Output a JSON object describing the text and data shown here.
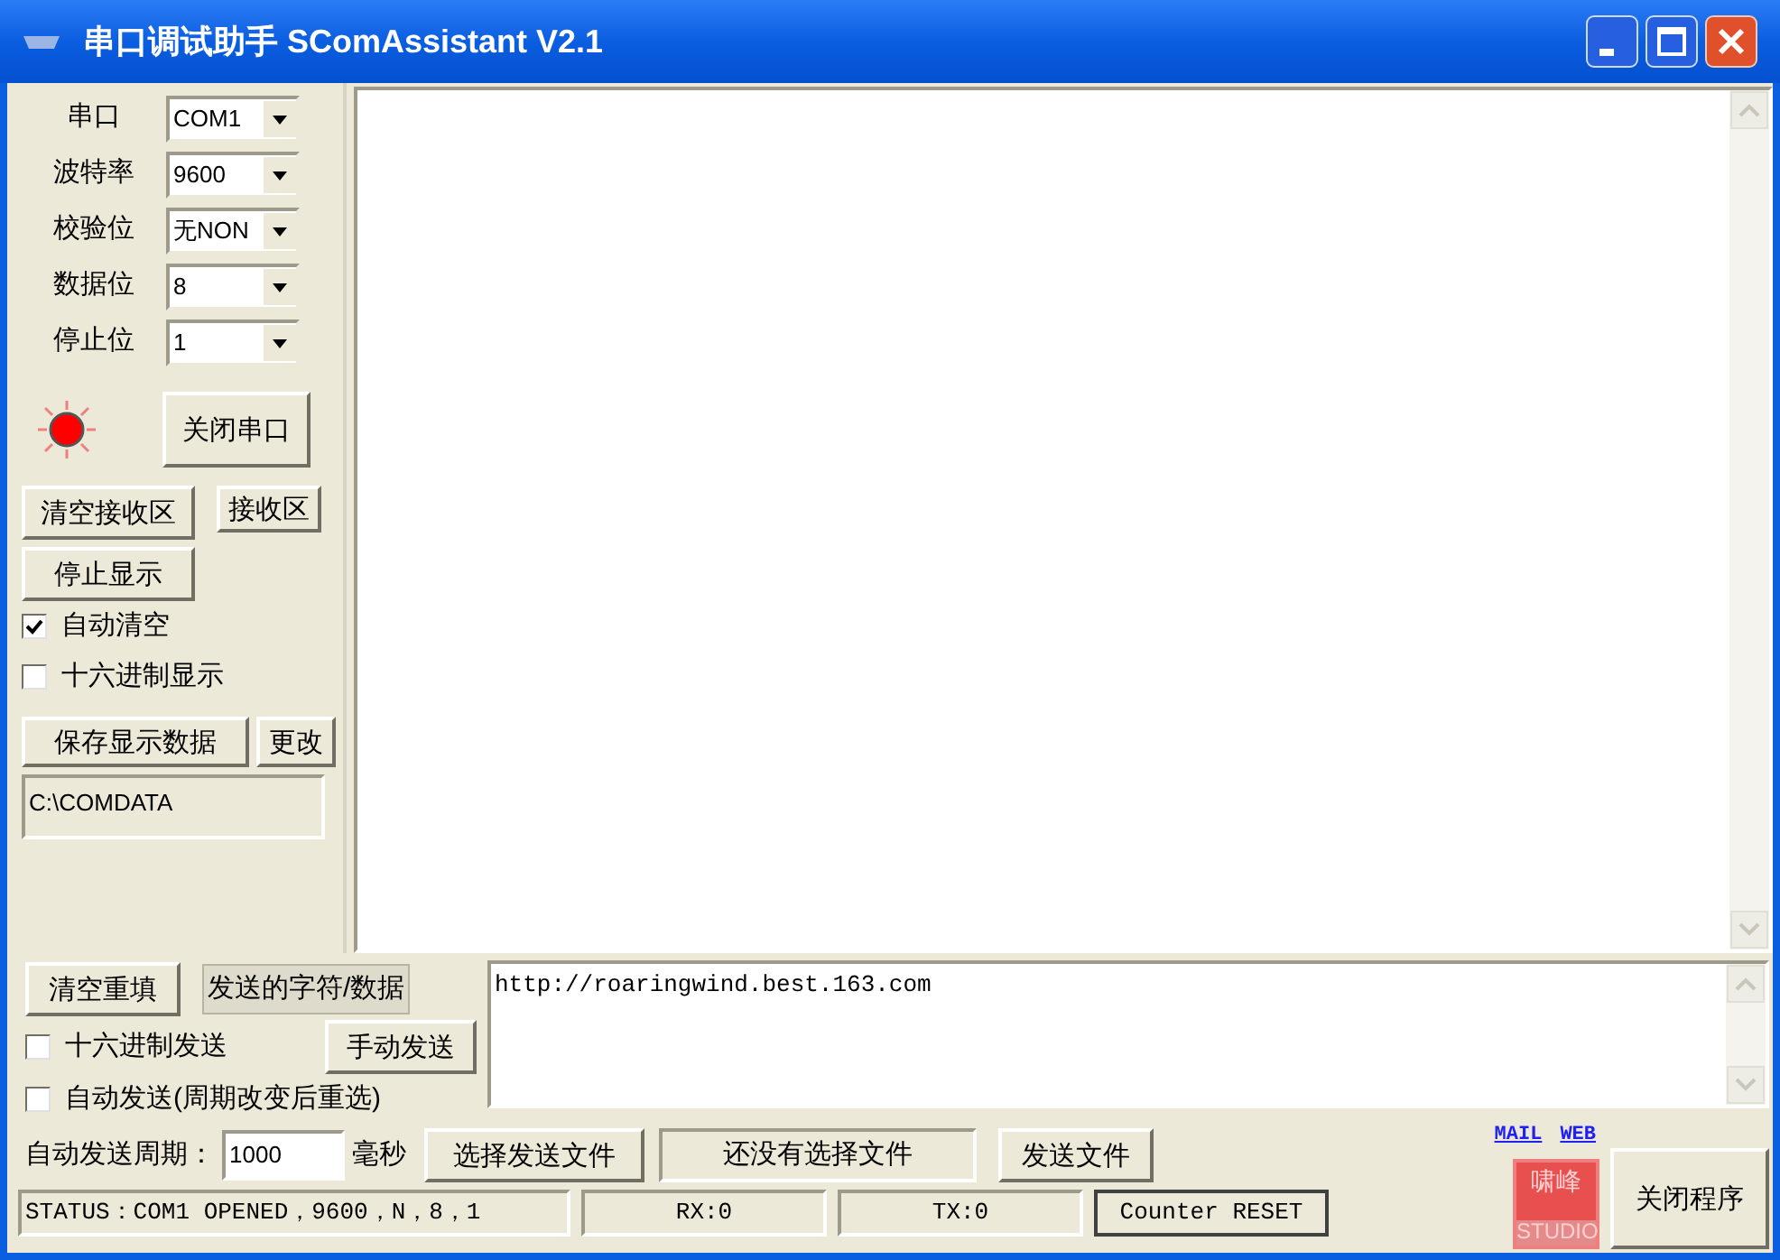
{
  "window": {
    "title": "串口调试助手 SComAssistant V2.1"
  },
  "port_settings": [
    {
      "label": "串口",
      "value": "COM1"
    },
    {
      "label": "波特率",
      "value": "9600"
    },
    {
      "label": "校验位",
      "value": "无NON"
    },
    {
      "label": "数据位",
      "value": "8"
    },
    {
      "label": "停止位",
      "value": "1"
    }
  ],
  "port_indicator": {
    "on": true
  },
  "port_button": "关闭串口",
  "receive_buttons": [
    "清空接收区",
    "接收区"
  ],
  "stop_display_button": "停止显示",
  "receive_options": [
    {
      "label": "自动清空",
      "checked": true
    },
    {
      "label": "十六进制显示",
      "checked": false
    }
  ],
  "save_buttons": [
    "保存显示数据",
    "更改"
  ],
  "save_path": "C:\\COMDATA",
  "send": {
    "clear_button": "清空重填",
    "data_label": "发送的字符/数据",
    "text": "http://roaringwind.best.163.com",
    "hex_send": {
      "label": "十六进制发送",
      "checked": false
    },
    "manual_button": "手动发送",
    "auto_send": {
      "label": "自动发送(周期改变后重选)",
      "checked": false
    },
    "period_label": "自动发送周期：",
    "period_value": "1000",
    "period_unit": "毫秒",
    "choose_file_button": "选择发送文件",
    "file_field": "还没有选择文件",
    "send_file_button": "发送文件"
  },
  "links": [
    "MAIL",
    "WEB"
  ],
  "logo": {
    "top": "啸峰",
    "bottom": "STUDIO"
  },
  "close_button": "关闭程序",
  "status_bar": {
    "status": "STATUS：COM1 OPENED，9600，N，8，1",
    "rx": "RX:0",
    "tx": "TX:0",
    "reset_button": "Counter RESET"
  }
}
